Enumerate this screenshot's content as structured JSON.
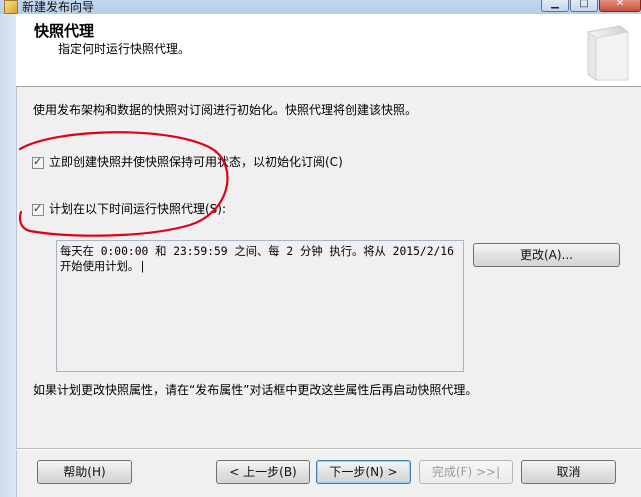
{
  "window": {
    "title": "新建发布向导"
  },
  "header": {
    "title": "快照代理",
    "subtitle": "指定何时运行快照代理。"
  },
  "main": {
    "description": "使用发布架构和数据的快照对订阅进行初始化。快照代理将创建该快照。",
    "checkbox_create_now": {
      "label": "立即创建快照并使快照保持可用状态，以初始化订阅(C)",
      "checked": true
    },
    "checkbox_schedule": {
      "label": "计划在以下时间运行快照代理(S):",
      "checked": true
    },
    "schedule_text": "每天在 0:00:00 和 23:59:59 之间、每 2 分钟 执行。将从 2015/2/16 开始使用计划。|",
    "change_button": "更改(A)...",
    "footer_note": "如果计划更改快照属性，请在“发布属性”对话框中更改这些属性后再启动快照代理。"
  },
  "buttons": {
    "help": "帮助(H)",
    "back": "< 上一步(B)",
    "next": "下一步(N) >",
    "finish": "完成(F) >>|",
    "cancel": "取消"
  },
  "colors": {
    "annotation": "#e0001a"
  }
}
